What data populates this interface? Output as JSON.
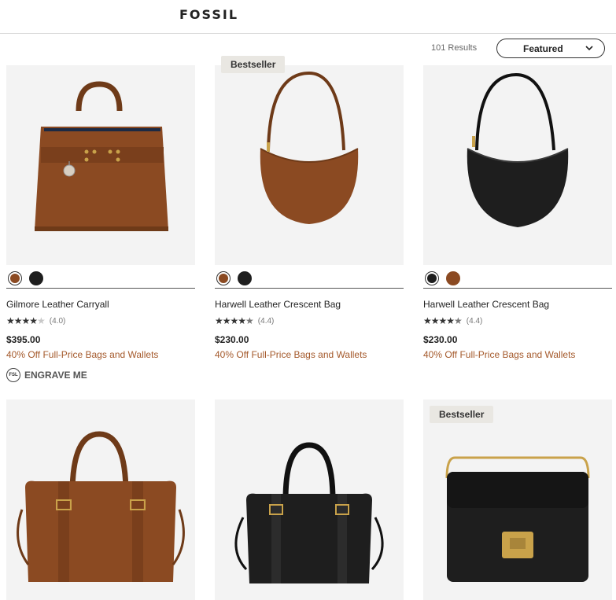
{
  "header": {
    "logo": "FOSSIL"
  },
  "toolbar": {
    "results": "101 Results",
    "sort_label": "Featured"
  },
  "products": [
    {
      "name": "Gilmore Leather Carryall",
      "rating": 4.0,
      "rating_text": "(4.0)",
      "price": "$395.00",
      "promo": "40% Off Full-Price Bags and Wallets",
      "badge": "",
      "swatches": [
        "#8b4a22",
        "#1e1e1e"
      ],
      "selected_swatch": 0,
      "engrave_icon": "FSL",
      "engrave_label": "ENGRAVE ME"
    },
    {
      "name": "Harwell Leather Crescent Bag",
      "rating": 4.4,
      "rating_text": "(4.4)",
      "price": "$230.00",
      "promo": "40% Off Full-Price Bags and Wallets",
      "badge": "Bestseller",
      "swatches": [
        "#8b4a22",
        "#1e1e1e"
      ],
      "selected_swatch": 0
    },
    {
      "name": "Harwell Leather Crescent Bag",
      "rating": 4.4,
      "rating_text": "(4.4)",
      "price": "$230.00",
      "promo": "40% Off Full-Price Bags and Wallets",
      "badge": "",
      "swatches": [
        "#1e1e1e",
        "#8b4a22"
      ],
      "selected_swatch": 0
    },
    {
      "name": "",
      "badge": ""
    },
    {
      "name": "",
      "badge": ""
    },
    {
      "name": "",
      "badge": "Bestseller"
    }
  ],
  "colors": {
    "accent": "#a4592b",
    "brown_leather": "#8b4a22",
    "black_leather": "#1e1e1e",
    "gold": "#c9a24a"
  }
}
